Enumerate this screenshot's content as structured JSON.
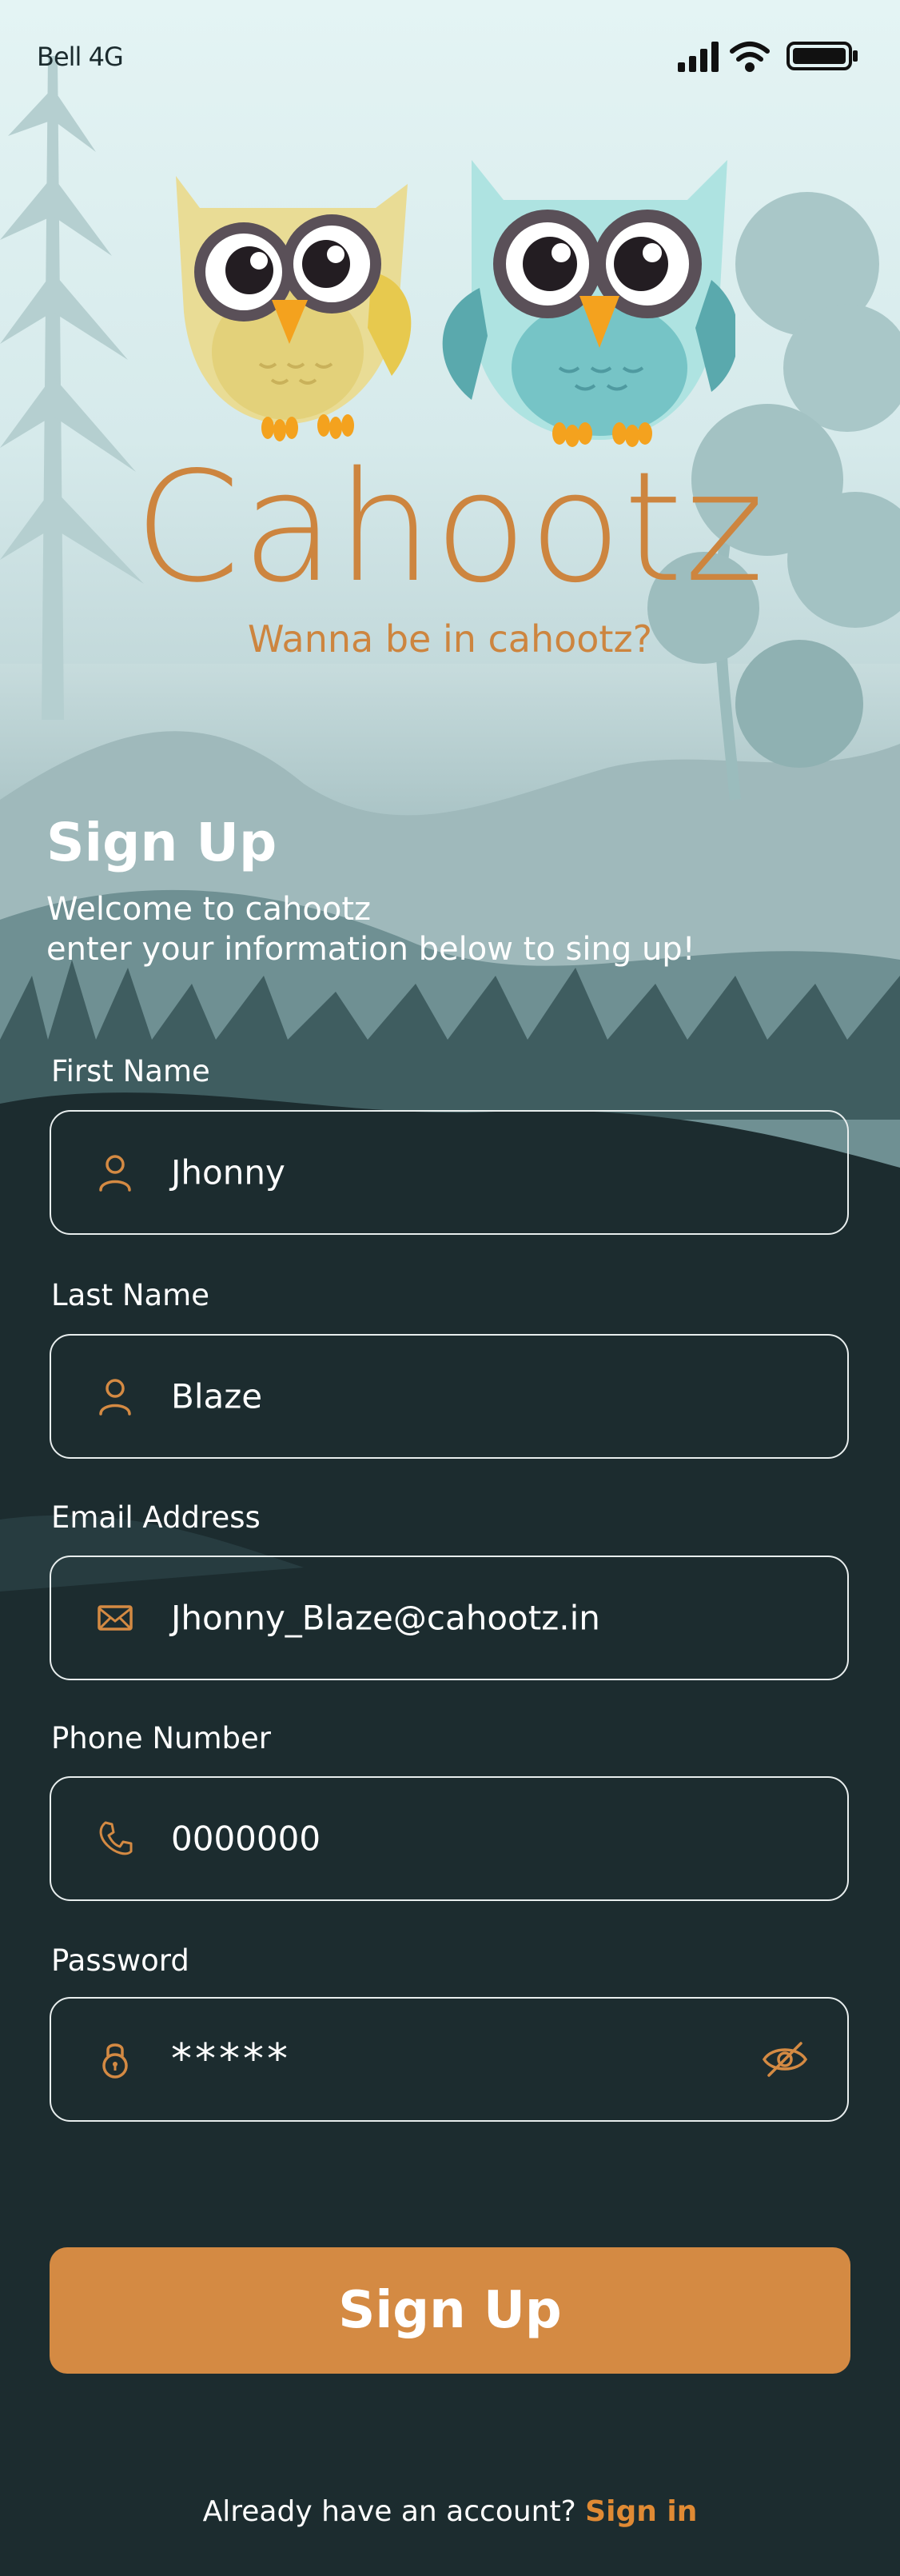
{
  "status_bar": {
    "carrier": "Bell 4G",
    "icons": [
      "signal-icon",
      "wifi-icon",
      "battery-icon"
    ]
  },
  "brand": {
    "logo": "owls-logo",
    "title": "Cahootz",
    "tagline": "Wanna be in cahootz?"
  },
  "heading": {
    "title": "Sign Up",
    "subtitle_line1": "Welcome to cahootz",
    "subtitle_line2": "enter your information below to sing up!"
  },
  "form": {
    "first_name": {
      "label": "First Name",
      "value": "Jhonny",
      "icon": "user-icon"
    },
    "last_name": {
      "label": "Last Name",
      "value": "Blaze",
      "icon": "user-icon"
    },
    "email": {
      "label": "Email Address",
      "value": "Jhonny_Blaze@cahootz.in",
      "icon": "envelope-icon"
    },
    "phone": {
      "label": "Phone Number",
      "value": "0000000",
      "icon": "phone-icon"
    },
    "password": {
      "label": "Password",
      "value": "*****",
      "icon": "lock-icon",
      "toggle_icon": "eye-off-icon"
    }
  },
  "actions": {
    "submit_label": "Sign Up"
  },
  "footer": {
    "prompt": "Already have an account?",
    "link": "Sign in"
  },
  "colors": {
    "accent": "#d48a43",
    "brand_text": "#cd853f",
    "background_dark": "#1c2c2f",
    "sky": "#dff1f2"
  }
}
